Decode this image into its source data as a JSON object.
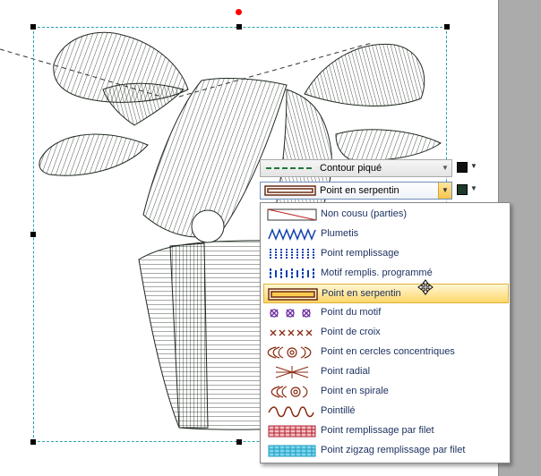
{
  "colors": {
    "accent": "#2aa0b0",
    "highlight": "#ffd76a",
    "thread": "#1f2a1f",
    "item_text": "#1b2f5e"
  },
  "toolbar": {
    "outline_type": {
      "label": "Contour piqué",
      "icon": "dashed-green-line"
    },
    "fill_type": {
      "label": "Point en serpentin",
      "icon": "satin-serpentine-swatch"
    },
    "outline_color": "#101010",
    "fill_color": "#1e3a28"
  },
  "dropdown": {
    "selected": "Point en serpentin",
    "items": [
      {
        "label": "Non cousu (parties)",
        "icon": "no-stitch-swatch"
      },
      {
        "label": "Plumetis",
        "icon": "plumetis-zigzag-swatch"
      },
      {
        "label": "Point remplissage",
        "icon": "fill-stitch-swatch"
      },
      {
        "label": "Motif remplis. programmé",
        "icon": "programmed-fill-swatch"
      },
      {
        "label": "Point en serpentin",
        "icon": "serpentine-swatch"
      },
      {
        "label": "Point du motif",
        "icon": "motif-stitch-swatch"
      },
      {
        "label": "Point de croix",
        "icon": "cross-stitch-swatch"
      },
      {
        "label": "Point en cercles concentriques",
        "icon": "concentric-circles-swatch"
      },
      {
        "label": "Point radial",
        "icon": "radial-stitch-swatch"
      },
      {
        "label": "Point en spirale",
        "icon": "spiral-stitch-swatch"
      },
      {
        "label": "Pointillé",
        "icon": "stippling-swatch"
      },
      {
        "label": "Point remplissage par filet",
        "icon": "net-fill-swatch"
      },
      {
        "label": "Point zigzag remplissage par filet",
        "icon": "zigzag-net-fill-swatch"
      }
    ]
  }
}
